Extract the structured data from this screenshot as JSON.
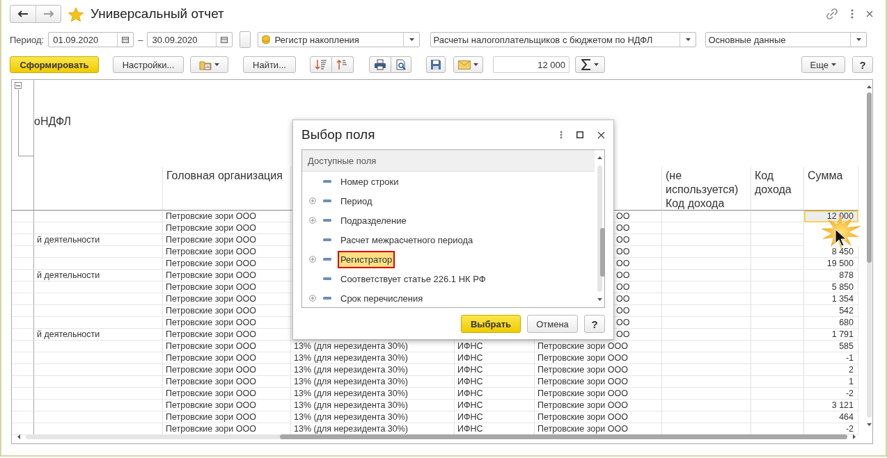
{
  "window": {
    "title": "Универсальный отчет",
    "favorite": true
  },
  "filters": {
    "period_label": "Период:",
    "date_from": "01.09.2020",
    "separator": "–",
    "date_to": "30.09.2020",
    "source_type": "Регистр накопления",
    "source": "Расчеты налогоплательщиков с бюджетом по НДФЛ",
    "variant": "Основные данные"
  },
  "toolbar": {
    "generate": "Сформировать",
    "settings": "Настройки...",
    "find": "Найти...",
    "sum_value": "12 000",
    "more": "Еще",
    "help": "?"
  },
  "report": {
    "group_header": "оНДФЛ",
    "group_expanded": true,
    "headings": {
      "column_2": "Головная организация",
      "column_6": "(не используется) Код дохода",
      "column_7": "Код дохода",
      "column_8": "Сумма"
    },
    "rows": [
      {
        "column_2": "Петровские зори ООО",
        "column_5": "ОО",
        "column_8": "12 000",
        "covered": true,
        "selected": true
      },
      {
        "column_2": "Петровские зори ООО",
        "column_5": "ОО",
        "covered": true,
        "selected": false
      },
      {
        "column_1": "й деятельности",
        "column_2": "Петровские зори ООО",
        "column_5": "ОО",
        "covered": true,
        "selected": false
      },
      {
        "column_2": "Петровские зори ООО",
        "column_5": "ОО",
        "column_8": "8 450",
        "covered": true,
        "selected": false
      },
      {
        "column_2": "Петровские зори ООО",
        "column_5": "ОО",
        "column_8": "19 500",
        "covered": true,
        "selected": false
      },
      {
        "column_1": "й деятельности",
        "column_2": "Петровские зори ООО",
        "column_5": "ОО",
        "column_8": "878",
        "covered": true,
        "selected": false
      },
      {
        "column_2": "Петровские зори ООО",
        "column_5": "ОО",
        "column_8": "5 850",
        "covered": true,
        "selected": false
      },
      {
        "column_2": "Петровские зори ООО",
        "column_5": "ОО",
        "column_8": "1 354",
        "covered": true,
        "selected": false
      },
      {
        "column_2": "Петровские зори ООО",
        "column_5": "ОО",
        "column_8": "542",
        "covered": true,
        "selected": false
      },
      {
        "column_2": "Петровские зори ООО",
        "column_5": "ОО",
        "column_8": "680",
        "covered": true,
        "selected": false
      },
      {
        "column_1": "й деятельности",
        "column_2": "Петровские зори ООО",
        "column_5": "ОО",
        "column_8": "1 791",
        "covered": true,
        "selected": false
      },
      {
        "column_2": "Петровские зори ООО",
        "column_3": "13% (для нерезидента 30%)",
        "column_4": "ИФНС",
        "column_5": "Петровские зори ООО",
        "column_8": "585",
        "covered": false,
        "selected": false
      },
      {
        "column_2": "Петровские зори ООО",
        "column_3": "13% (для нерезидента 30%)",
        "column_4": "ИФНС",
        "column_5": "Петровские зори ООО",
        "column_8": "-1",
        "covered": false,
        "selected": false
      },
      {
        "column_2": "Петровские зори ООО",
        "column_3": "13% (для нерезидента 30%)",
        "column_4": "ИФНС",
        "column_5": "Петровские зори ООО",
        "column_8": "2",
        "covered": false,
        "selected": false
      },
      {
        "column_2": "Петровские зори ООО",
        "column_3": "13% (для нерезидента 30%)",
        "column_4": "ИФНС",
        "column_5": "Петровские зори ООО",
        "column_8": "1",
        "covered": false,
        "selected": false
      },
      {
        "column_2": "Петровские зори ООО",
        "column_3": "13% (для нерезидента 30%)",
        "column_4": "ИФНС",
        "column_5": "Петровские зори ООО",
        "column_8": "-2",
        "covered": false,
        "selected": false
      },
      {
        "column_2": "Петровские зори ООО",
        "column_3": "13% (для нерезидента 30%)",
        "column_4": "ИФНС",
        "column_5": "Петровские зори ООО",
        "column_8": "3 121",
        "covered": false,
        "selected": false
      },
      {
        "column_2": "Петровские зори ООО",
        "column_3": "13% (для нерезидента 30%)",
        "column_4": "ИФНС",
        "column_5": "Петровские зори ООО",
        "column_8": "464",
        "covered": false,
        "selected": false
      },
      {
        "column_2": "Петровские зори ООО",
        "column_3": "13% (для нерезидента 30%)",
        "column_4": "ИФНС",
        "column_5": "Петровские зори ООО",
        "column_8": "-2",
        "covered": false,
        "selected": false
      }
    ]
  },
  "dialog": {
    "title": "Выбор поля",
    "list_header": "Доступные поля",
    "items": [
      {
        "label": "Номер строки",
        "expandable": false,
        "selected": false
      },
      {
        "label": "Период",
        "expandable": true,
        "selected": false
      },
      {
        "label": "Подразделение",
        "expandable": true,
        "selected": false
      },
      {
        "label": "Расчет межрасчетного периода",
        "expandable": false,
        "selected": false
      },
      {
        "label": "Регистратор",
        "expandable": true,
        "selected": true
      },
      {
        "label": "Соответствует статье 226.1 НК РФ",
        "expandable": false,
        "selected": false
      },
      {
        "label": "Срок перечисления",
        "expandable": true,
        "selected": false
      }
    ],
    "buttons": [
      {
        "label": "Выбрать",
        "kind": "default"
      },
      {
        "label": "Отмена",
        "kind": "normal"
      },
      {
        "label": "?",
        "kind": "help"
      }
    ]
  }
}
